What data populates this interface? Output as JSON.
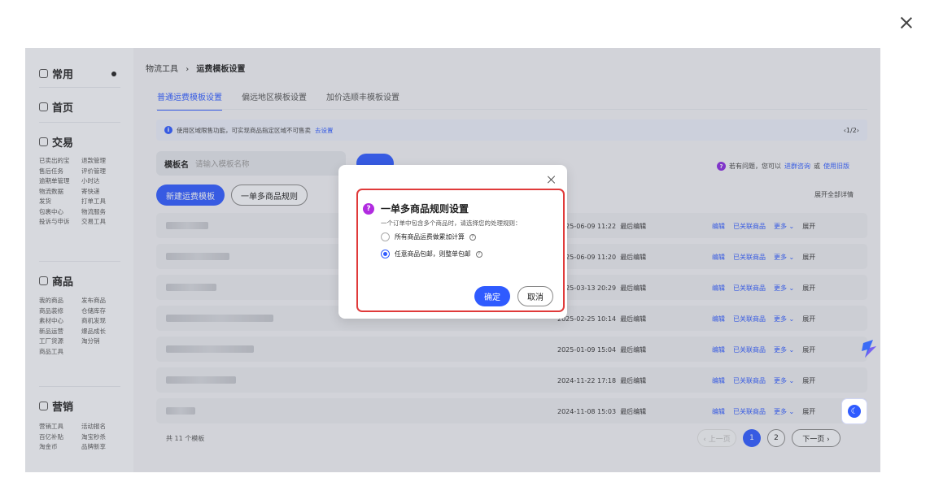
{
  "sidebar": {
    "sections": [
      {
        "title": "常用",
        "icon": "clock-icon"
      },
      {
        "title": "首页",
        "icon": "home-icon"
      },
      {
        "title": "交易",
        "icon": "trade-icon",
        "items": [
          "已卖出的宝",
          "退款管理",
          "售后任务",
          "评价管理",
          "逾期单管理",
          "小时达",
          "物流数据",
          "寄快递",
          "发货",
          "打单工具",
          "包裹中心",
          "物流服务",
          "投诉与申诉",
          "交易工具"
        ]
      },
      {
        "title": "商品",
        "icon": "goods-icon",
        "items": [
          "我的商品",
          "发布商品",
          "商品装修",
          "仓储库存",
          "素材中心",
          "商机发现",
          "新品运营",
          "爆品成长",
          "工厂货源",
          "淘分销",
          "商品工具"
        ]
      },
      {
        "title": "营销",
        "icon": "marketing-icon",
        "items": [
          "营销工具",
          "活动报名",
          "百亿补贴",
          "淘宝秒杀",
          "淘金币",
          "品牌新享"
        ]
      }
    ]
  },
  "breadcrumb": {
    "parent": "物流工具",
    "sep": "›",
    "current": "运费模板设置"
  },
  "tabs": [
    "普通运费模板设置",
    "偏远地区模板设置",
    "加价选顺丰模板设置"
  ],
  "notice": {
    "text": "使用区域限售功能，可实现商品指定区域不可售卖",
    "link": "去设置",
    "pager": "‹1/2›"
  },
  "filter": {
    "label": "模板名",
    "placeholder": "请输入模板名称"
  },
  "help": {
    "text": "若有问题，您可以",
    "link1": "进群咨询",
    "or": "或",
    "link2": "使用旧版"
  },
  "buttons": {
    "new_template": "新建运费模板",
    "multi_rule": "一单多商品规则",
    "expand_all": "展开全部详情"
  },
  "rows": [
    {
      "date": "2025-06-09 11:22",
      "status": "最后编辑"
    },
    {
      "date": "2025-06-09 11:20",
      "status": "最后编辑"
    },
    {
      "date": "2025-03-13 20:29",
      "status": "最后编辑"
    },
    {
      "date": "2025-02-25 10:14",
      "status": "最后编辑"
    },
    {
      "date": "2025-01-09 15:04",
      "status": "最后编辑"
    },
    {
      "date": "2024-11-22 17:18",
      "status": "最后编辑"
    },
    {
      "date": "2024-11-08 15:03",
      "status": "最后编辑"
    }
  ],
  "row_actions": {
    "edit": "编辑",
    "linked": "已关联商品",
    "more": "更多",
    "expand": "展开"
  },
  "pagination": {
    "total": "共 11 个模板",
    "prev": "‹ 上一页",
    "pages": [
      "1",
      "2"
    ],
    "current": "1",
    "next": "下一页 ›"
  },
  "dialog": {
    "title": "一单多商品规则设置",
    "desc": "一个订单中包含多个商品时，请选择您的处理规则：",
    "options": [
      {
        "label": "所有商品运费做累加计算",
        "selected": false
      },
      {
        "label": "任意商品包邮，则整单包邮",
        "selected": true
      }
    ],
    "ok": "确定",
    "cancel": "取消"
  }
}
